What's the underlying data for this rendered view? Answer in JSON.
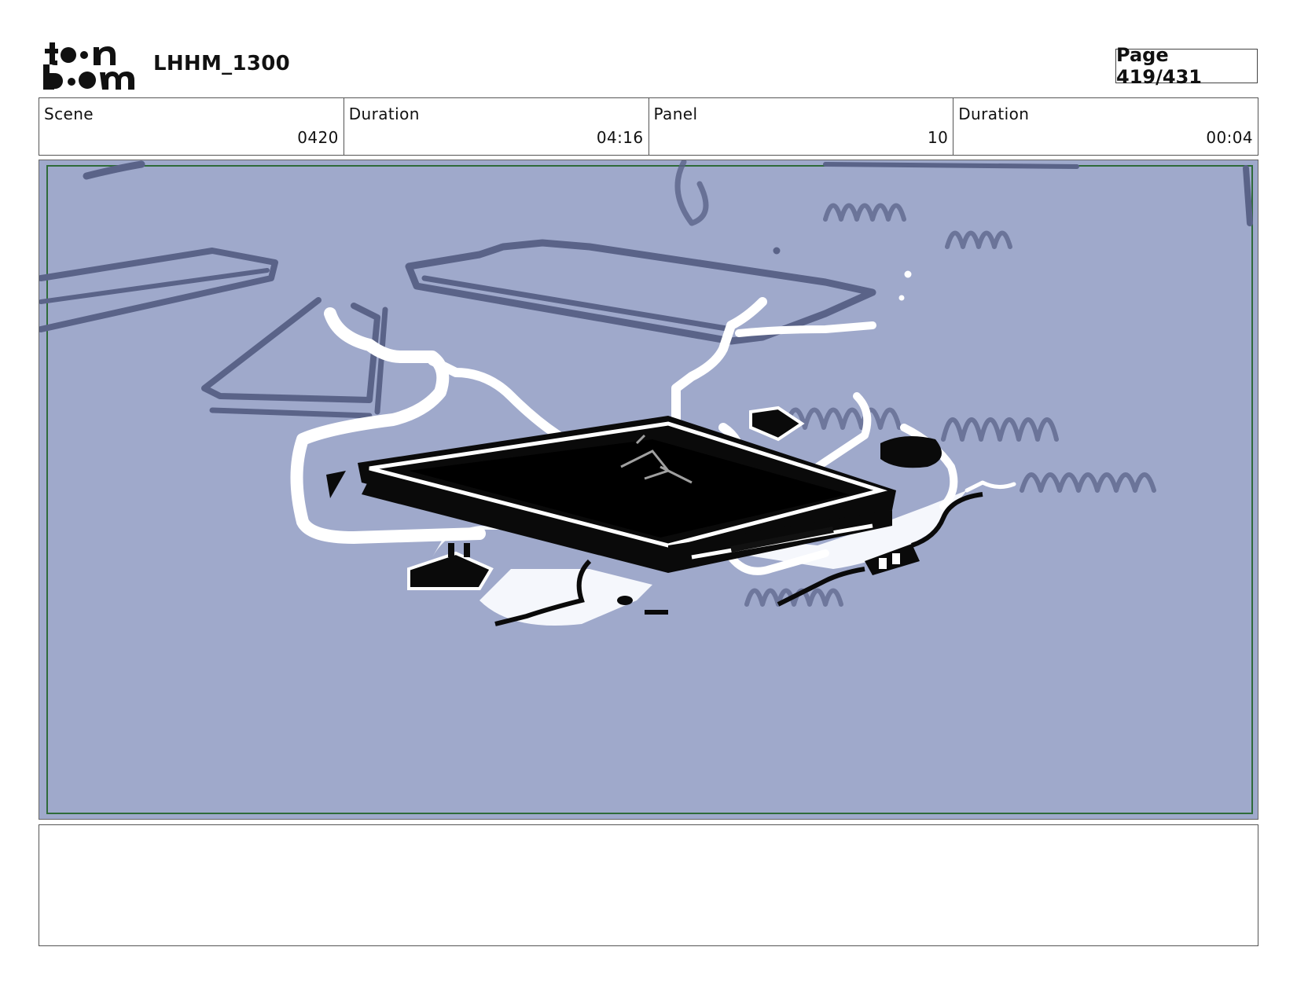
{
  "header": {
    "logo_icon": "toon-boom-logo",
    "project_title": "LHHM_1300",
    "page_label": "Page 419/431"
  },
  "info": {
    "scene_label": "Scene",
    "scene_value": "0420",
    "scene_duration_label": "Duration",
    "scene_duration_value": "04:16",
    "panel_label": "Panel",
    "panel_value": "10",
    "panel_duration_label": "Duration",
    "panel_duration_value": "00:04"
  },
  "panel": {
    "background_color": "#9fa9cb",
    "safe_frame_color": "#2f6b3a",
    "sketch_ink_color": "#5a6388"
  },
  "notes": {
    "text": ""
  }
}
